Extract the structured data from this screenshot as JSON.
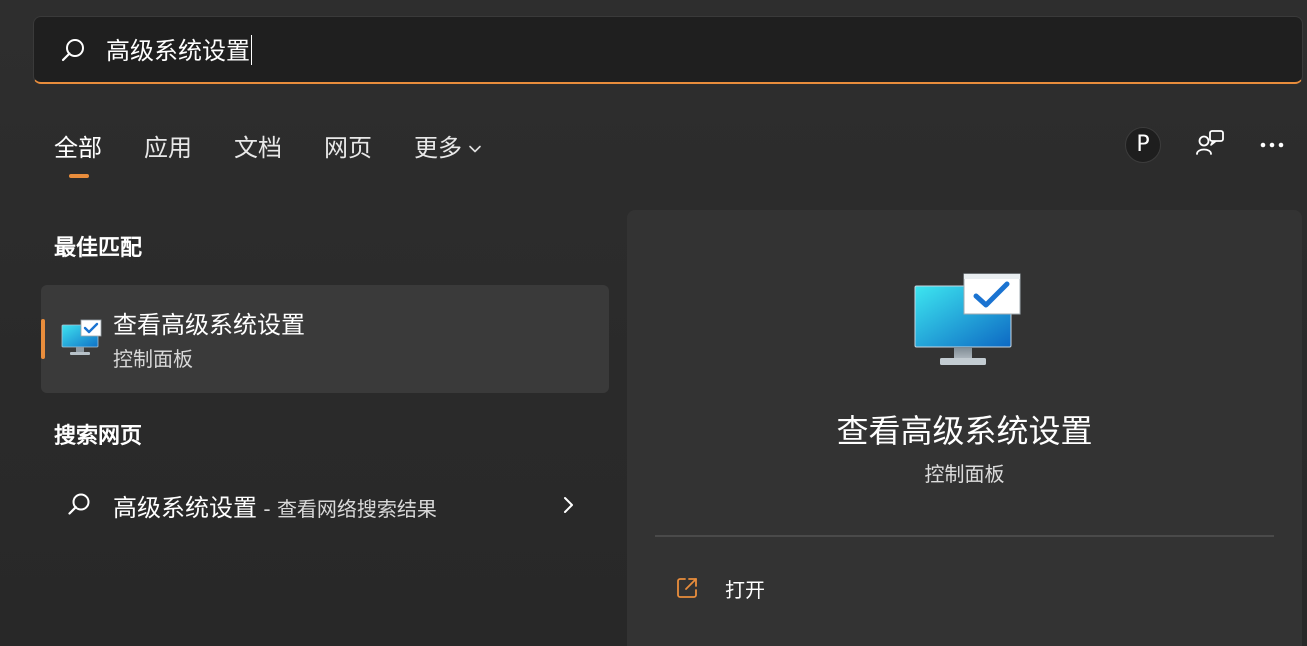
{
  "search": {
    "query": "高级系统设置"
  },
  "tabs": [
    {
      "label": "全部"
    },
    {
      "label": "应用"
    },
    {
      "label": "文档"
    },
    {
      "label": "网页"
    },
    {
      "label": "更多"
    }
  ],
  "account": {
    "avatar_letter": "P"
  },
  "best_match": {
    "section_title": "最佳匹配",
    "title": "查看高级系统设置",
    "subtitle": "控制面板"
  },
  "web_search": {
    "section_title": "搜索网页",
    "query": "高级系统设置",
    "separator": " - ",
    "suffix": "查看网络搜索结果"
  },
  "detail": {
    "title": "查看高级系统设置",
    "subtitle": "控制面板",
    "open_label": "打开"
  },
  "colors": {
    "accent": "#e98d3c",
    "background": "#2b2b2b",
    "panel": "#333333",
    "selected_item": "#3a3a3a"
  },
  "icons": {
    "search": "search-icon",
    "chevron_down": "chevron-down-icon",
    "chevron_right": "chevron-right-icon",
    "feedback": "feedback-icon",
    "more": "more-horizontal-icon",
    "system_properties": "system-properties-icon",
    "open": "open-external-icon"
  }
}
